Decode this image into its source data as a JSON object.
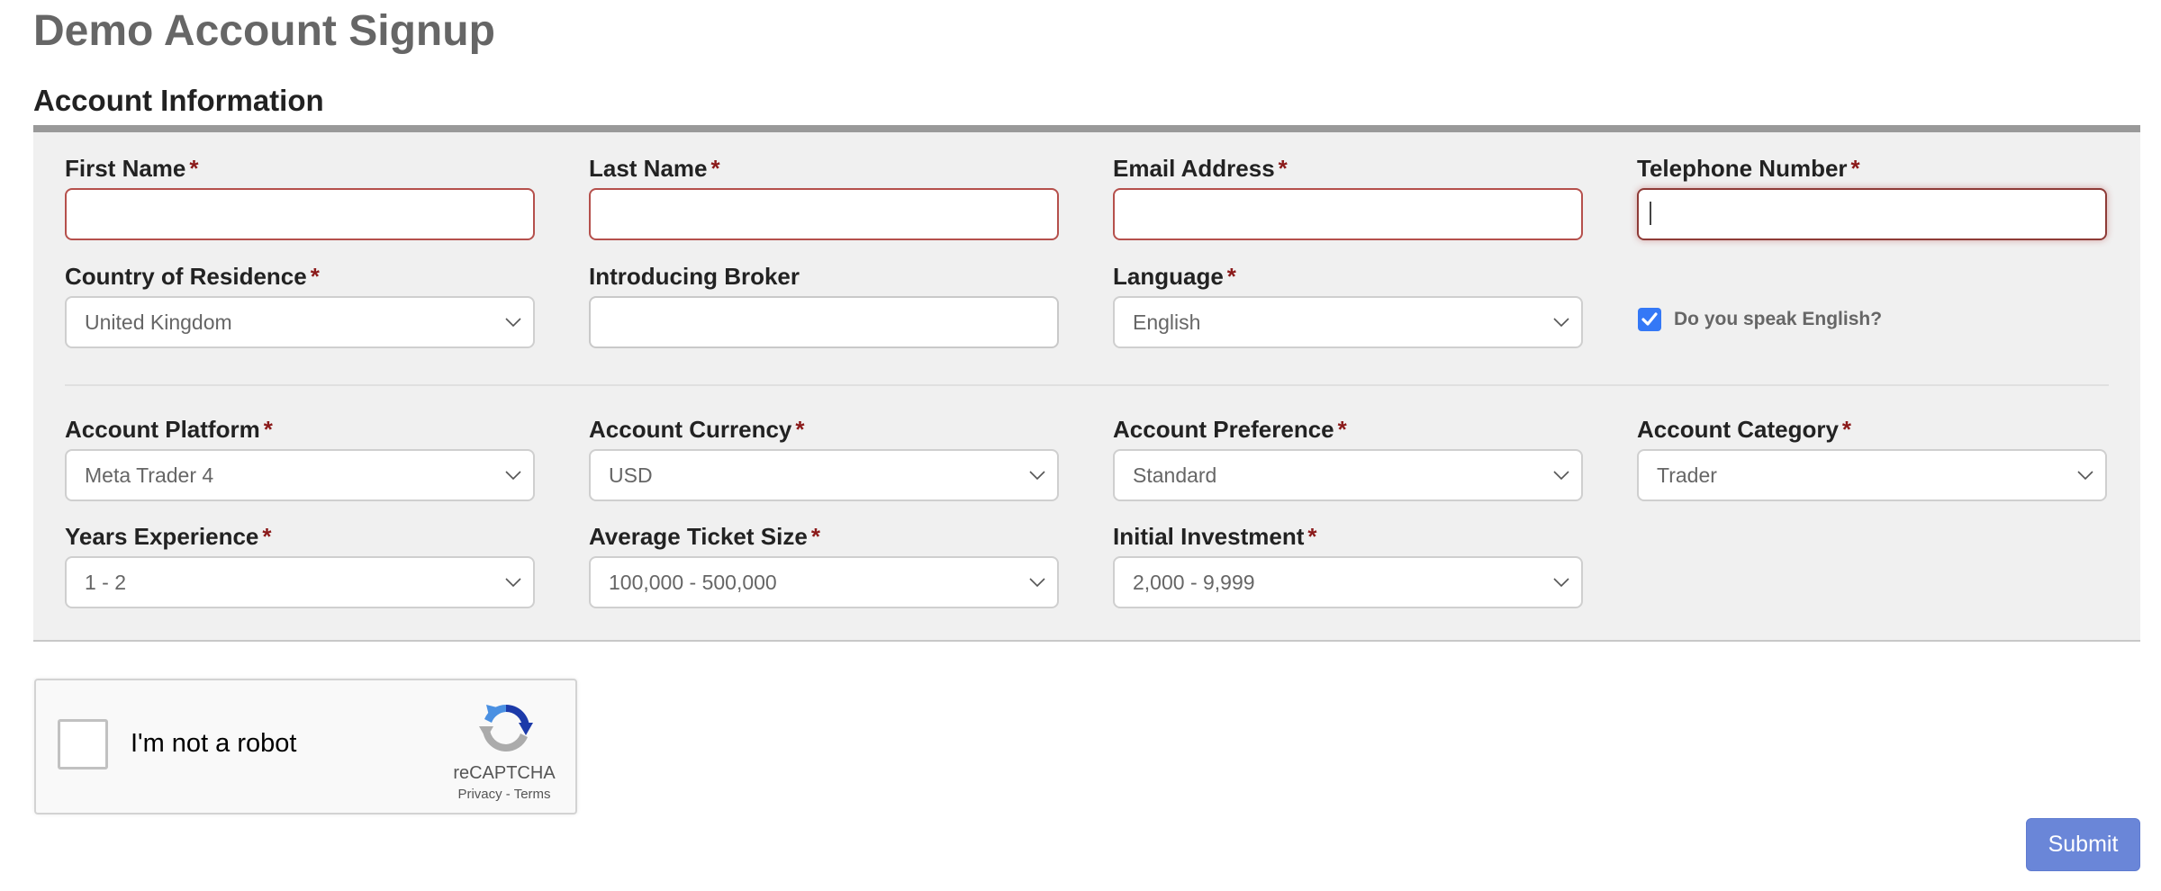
{
  "page": {
    "title": "Demo Account Signup",
    "section_heading": "Account Information"
  },
  "required_marker": "*",
  "fields": {
    "first_name": {
      "label": "First Name",
      "value": "",
      "required": true,
      "state": "invalid"
    },
    "last_name": {
      "label": "Last Name",
      "value": "",
      "required": true,
      "state": "invalid"
    },
    "email": {
      "label": "Email Address",
      "value": "",
      "required": true,
      "state": "invalid"
    },
    "telephone": {
      "label": "Telephone Number",
      "value": "",
      "required": true,
      "state": "focused-invalid"
    },
    "country": {
      "label": "Country of Residence",
      "value": "United Kingdom",
      "required": true
    },
    "introducing_broker": {
      "label": "Introducing Broker",
      "value": "",
      "required": false
    },
    "language": {
      "label": "Language",
      "value": "English",
      "required": true
    },
    "speak_english": {
      "label": "Do you speak English?",
      "checked": true
    },
    "account_platform": {
      "label": "Account Platform",
      "value": "Meta Trader 4",
      "required": true
    },
    "account_currency": {
      "label": "Account Currency",
      "value": "USD",
      "required": true
    },
    "account_preference": {
      "label": "Account Preference",
      "value": "Standard",
      "required": true
    },
    "account_category": {
      "label": "Account Category",
      "value": "Trader",
      "required": true
    },
    "years_experience": {
      "label": "Years Experience",
      "value": "1 - 2",
      "required": true
    },
    "average_ticket_size": {
      "label": "Average Ticket Size",
      "value": "100,000 - 500,000",
      "required": true
    },
    "initial_investment": {
      "label": "Initial Investment",
      "value": "2,000 - 9,999",
      "required": true
    }
  },
  "recaptcha": {
    "label": "I'm not a robot",
    "checked": false,
    "brand": "reCAPTCHA",
    "privacy_link": "Privacy",
    "separator": " - ",
    "terms_link": "Terms"
  },
  "actions": {
    "submit_label": "Submit"
  },
  "colors": {
    "required": "#8b1a1a",
    "invalid_border": "#b5504c",
    "checkbox": "#3478f6",
    "submit": "#6a86d8",
    "panel_bg": "#f0f0f0",
    "panel_border": "#999999"
  }
}
